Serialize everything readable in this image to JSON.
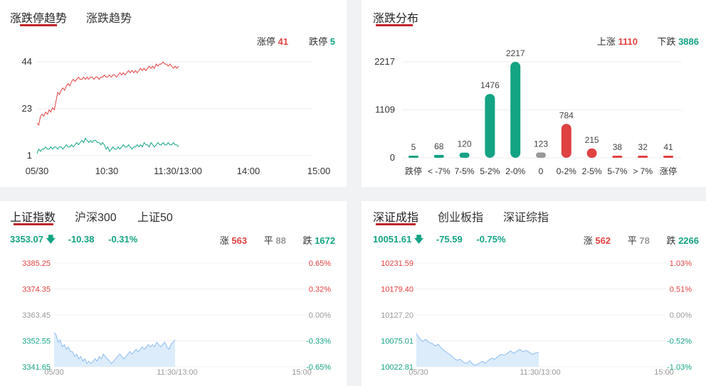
{
  "trend_panel": {
    "tabs": [
      {
        "label": "涨跌停趋势",
        "active": true
      },
      {
        "label": "涨跌趋势",
        "active": false
      }
    ],
    "up_limit_label": "涨停",
    "up_limit_value": "41",
    "down_limit_label": "跌停",
    "down_limit_value": "5"
  },
  "dist_panel": {
    "tab": "涨跌分布",
    "rise_label": "上涨",
    "rise_value": "1110",
    "fall_label": "下跌",
    "fall_value": "3886"
  },
  "sh_panel": {
    "tabs": [
      {
        "label": "上证指数",
        "active": true
      },
      {
        "label": "沪深300",
        "active": false
      },
      {
        "label": "上证50",
        "active": false
      }
    ],
    "price": "3353.07",
    "arrow": "🡇",
    "change": "-10.38",
    "change_pct": "-0.31%",
    "up_label": "涨",
    "up": "563",
    "flat_label": "平",
    "flat": "88",
    "down_label": "跌",
    "down": "1672"
  },
  "sz_panel": {
    "tabs": [
      {
        "label": "深证成指",
        "active": true
      },
      {
        "label": "创业板指",
        "active": false
      },
      {
        "label": "深证综指",
        "active": false
      }
    ],
    "price": "10051.61",
    "arrow": "🡇",
    "change": "-75.59",
    "change_pct": "-0.75%",
    "up_label": "涨",
    "up": "562",
    "flat_label": "平",
    "flat": "78",
    "down_label": "跌",
    "down": "2266"
  },
  "colors": {
    "red": "#e04141",
    "green": "#14a383",
    "gray": "#999999",
    "accent": "#c0262c",
    "area": "#dcecfb",
    "area_line": "#8fbdf0"
  },
  "chart_data": [
    {
      "type": "line",
      "id": "limit_trend",
      "yticks": [
        "44",
        "23",
        "1"
      ],
      "ylim": [
        1,
        44
      ],
      "xticks": [
        "05/30",
        "10:30",
        "11:30/13:00",
        "14:00",
        "15:00"
      ],
      "series": [
        {
          "color": "#e04141",
          "values": [
            16,
            15,
            19,
            20,
            19,
            21,
            20,
            22,
            21,
            23,
            22,
            26,
            30,
            29,
            31,
            32,
            31,
            33,
            34,
            33,
            35,
            36,
            35,
            36,
            37,
            36,
            36,
            37,
            36,
            37,
            36,
            37,
            37,
            36,
            37,
            37,
            36,
            37,
            37,
            38,
            37,
            37,
            38,
            37,
            38,
            38,
            37,
            38,
            39,
            38,
            39,
            38,
            39,
            40,
            39,
            40,
            39,
            40,
            39,
            40,
            41,
            40,
            41,
            40,
            41,
            42,
            41,
            42,
            41,
            43,
            42,
            43,
            43,
            44,
            43,
            43,
            42,
            43,
            42,
            41,
            42,
            41,
            42
          ]
        },
        {
          "color": "#14a383",
          "values": [
            2,
            4,
            3,
            4,
            4,
            5,
            4,
            4,
            5,
            4,
            5,
            5,
            4,
            5,
            5,
            4,
            5,
            6,
            5,
            5,
            6,
            5,
            6,
            7,
            6,
            7,
            8,
            7,
            9,
            8,
            7,
            8,
            7,
            8,
            8,
            7,
            7,
            6,
            7,
            6,
            4,
            5,
            3,
            4,
            5,
            4,
            4,
            5,
            4,
            5,
            6,
            5,
            5,
            6,
            5,
            4,
            5,
            5,
            6,
            5,
            6,
            5,
            7,
            6,
            6,
            5,
            7,
            6,
            5,
            6,
            7,
            6,
            6,
            7,
            6,
            6,
            7,
            6,
            6,
            7,
            6,
            6,
            5
          ]
        }
      ]
    },
    {
      "type": "bar",
      "id": "distribution",
      "yticks": [
        "2217",
        "1109",
        "0"
      ],
      "ylim": [
        0,
        2217
      ],
      "categories": [
        "跌停",
        "< -7%",
        "7-5%",
        "5-2%",
        "2-0%",
        "0",
        "0-2%",
        "2-5%",
        "5-7%",
        "> 7%",
        "涨停"
      ],
      "values": [
        5,
        68,
        120,
        1476,
        2217,
        123,
        784,
        215,
        38,
        32,
        41
      ],
      "colors": [
        "#14a383",
        "#14a383",
        "#14a383",
        "#14a383",
        "#14a383",
        "#999999",
        "#e04141",
        "#e04141",
        "#e04141",
        "#e04141",
        "#e04141"
      ]
    },
    {
      "type": "area",
      "id": "sh_index",
      "left_ticks": [
        "3385.25",
        "3374.35",
        "3363.45",
        "3352.55",
        "3341.65"
      ],
      "right_ticks": [
        "0.65%",
        "0.32%",
        "0.00%",
        "-0.33%",
        "-0.65%"
      ],
      "xticks": [
        "05/30",
        "11:30/13:00",
        "15:00"
      ],
      "ylim": [
        3341.65,
        3385.25
      ],
      "values": [
        3356,
        3355,
        3352,
        3353,
        3350,
        3351,
        3349,
        3350,
        3348,
        3348,
        3346,
        3347,
        3345,
        3346,
        3344,
        3345,
        3343,
        3344,
        3343,
        3344,
        3345,
        3344,
        3346,
        3345,
        3347,
        3346,
        3345,
        3344,
        3343,
        3344,
        3345,
        3346,
        3347,
        3346,
        3345,
        3346,
        3347,
        3348,
        3347,
        3348,
        3349,
        3348,
        3349,
        3350,
        3349,
        3350,
        3351,
        3350,
        3351,
        3350,
        3352,
        3351,
        3350,
        3351,
        3352,
        3350,
        3349,
        3351,
        3352,
        3353
      ]
    },
    {
      "type": "area",
      "id": "sz_index",
      "left_ticks": [
        "10231.59",
        "10179.40",
        "10127.20",
        "10075.01",
        "10022.81"
      ],
      "right_ticks": [
        "1.03%",
        "0.51%",
        "0.00%",
        "-0.52%",
        "-1.03%"
      ],
      "xticks": [
        "05/30",
        "11:30/13:00",
        "15:00"
      ],
      "ylim": [
        10022.81,
        10231.59
      ],
      "values": [
        10090,
        10080,
        10074,
        10078,
        10072,
        10070,
        10065,
        10068,
        10060,
        10055,
        10050,
        10046,
        10040,
        10036,
        10038,
        10032,
        10030,
        10035,
        10028,
        10026,
        10030,
        10034,
        10030,
        10036,
        10040,
        10038,
        10044,
        10048,
        10046,
        10050,
        10055,
        10050,
        10054,
        10058,
        10053,
        10056,
        10052,
        10048,
        10051,
        10052
      ]
    }
  ]
}
